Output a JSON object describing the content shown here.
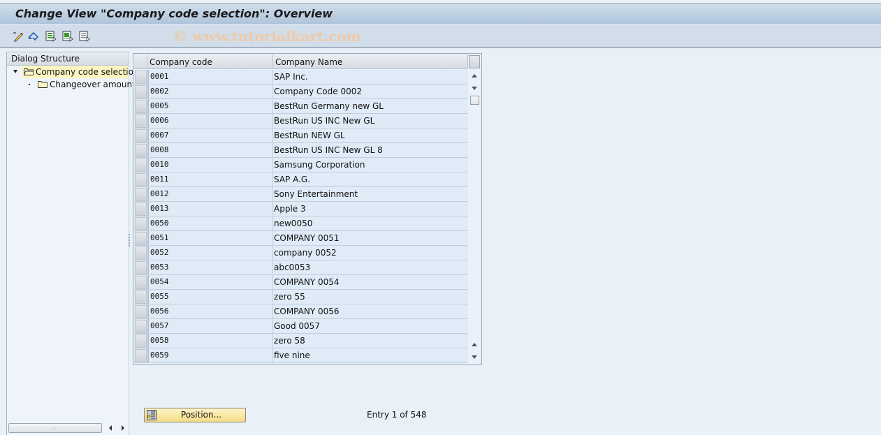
{
  "window": {
    "title": "Change View \"Company code selection\": Overview",
    "watermark": "© www.tutorialkart.com"
  },
  "toolbar": {
    "icons": [
      "display-change-icon",
      "undo-icon",
      "select-all-icon",
      "select-block-icon",
      "deselect-all-icon"
    ]
  },
  "dialog_structure": {
    "header": "Dialog Structure",
    "items": [
      {
        "label": "Company code selection",
        "level": 0,
        "expanded": true,
        "selected": true,
        "icon": "folder-open-icon"
      },
      {
        "label": "Changeover amount",
        "level": 1,
        "expanded": false,
        "selected": false,
        "icon": "folder-icon"
      }
    ]
  },
  "table": {
    "columns": [
      "Company code",
      "Company Name"
    ],
    "rows": [
      {
        "code": "0001",
        "name": "SAP Inc."
      },
      {
        "code": "0002",
        "name": "Company Code 0002"
      },
      {
        "code": "0005",
        "name": "BestRun Germany new GL"
      },
      {
        "code": "0006",
        "name": "BestRun US INC New GL"
      },
      {
        "code": "0007",
        "name": "BestRun NEW GL"
      },
      {
        "code": "0008",
        "name": "BestRun US INC New GL 8"
      },
      {
        "code": "0010",
        "name": "Samsung Corporation"
      },
      {
        "code": "0011",
        "name": "SAP A.G."
      },
      {
        "code": "0012",
        "name": "Sony Entertainment"
      },
      {
        "code": "0013",
        "name": "Apple 3"
      },
      {
        "code": "0050",
        "name": "new0050"
      },
      {
        "code": "0051",
        "name": "COMPANY 0051"
      },
      {
        "code": "0052",
        "name": "company 0052"
      },
      {
        "code": "0053",
        "name": "abc0053"
      },
      {
        "code": "0054",
        "name": "COMPANY 0054"
      },
      {
        "code": "0055",
        "name": "zero 55"
      },
      {
        "code": "0056",
        "name": "COMPANY 0056"
      },
      {
        "code": "0057",
        "name": "Good 0057"
      },
      {
        "code": "0058",
        "name": "zero 58"
      },
      {
        "code": "0059",
        "name": "five nine"
      }
    ]
  },
  "footer": {
    "position_button": "Position...",
    "entry_text": "Entry 1 of 548"
  },
  "colors": {
    "title_gradient_top": "#d0deea",
    "title_gradient_bottom": "#aec4dc",
    "selection_highlight": "#fdf6c3",
    "row_background": "#dfebf6",
    "button_yellow": "#f4dc86"
  }
}
